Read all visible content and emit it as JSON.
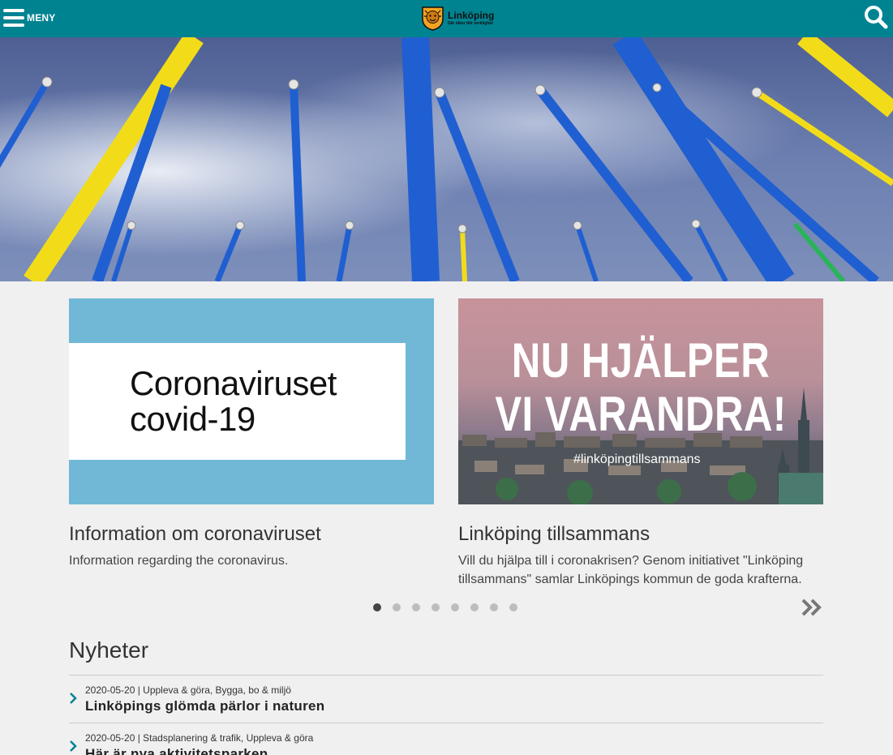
{
  "header": {
    "menu_label": "MENY",
    "logo_name": "Linköping",
    "logo_slogan": "Där idéer blir verklighet",
    "bg_color": "#008391"
  },
  "icons": {
    "menu": "hamburger-icon",
    "logo": "lion-crest-icon",
    "search": "search-icon",
    "next": "double-chevron-right-icon",
    "news_item": "chevron-right-icon"
  },
  "hero": {
    "description_icon": "flagpoles-photo"
  },
  "cards": [
    {
      "image_text_1": "Coronaviruset",
      "image_text_2": "covid-19",
      "title": "Information om coronaviruset",
      "description": "Information regarding the coronavirus."
    },
    {
      "image_text_1": "NU HJÄLPER",
      "image_text_2": "VI VARANDRA!",
      "image_hashtag": "#linköpingtillsammans",
      "title": "Linköping tillsammans",
      "description": "Vill du hjälpa till i coronakrisen? Genom initiativet \"Linköping tillsammans\" samlar Linköpings kommun de goda krafterna."
    }
  ],
  "carousel": {
    "slide_count": 8,
    "active_index": 0
  },
  "news": {
    "heading": "Nyheter",
    "items": [
      {
        "meta": "2020-05-20 | Uppleva & göra, Bygga, bo & miljö",
        "title": "Linköpings glömda pärlor i naturen"
      },
      {
        "meta": "2020-05-20 | Stadsplanering & trafik, Uppleva & göra",
        "title": "Här är nya aktivitetsparken"
      }
    ]
  }
}
